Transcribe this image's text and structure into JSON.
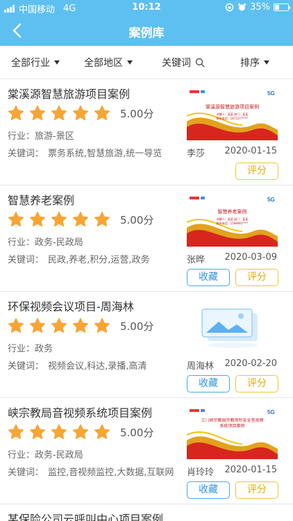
{
  "status": {
    "carrier": "中国移动",
    "network": "4G",
    "time": "10:12",
    "battery": "35%",
    "battery_level": 0.35
  },
  "nav": {
    "title": "案例库",
    "back_icon": "chevron-left-icon"
  },
  "filters": {
    "industry": "全部行业",
    "region": "全部地区",
    "keyword": "关键词",
    "sort": "排序"
  },
  "labels": {
    "industry_prefix": "行业：",
    "keyword_prefix": "关键词：",
    "favorite": "收藏",
    "rate": "评分",
    "score_unit": "分"
  },
  "colors": {
    "accent": "#5ec0f1",
    "star": "#f7a534",
    "favorite_border": "#46a8ea",
    "rate_border": "#f2c533"
  },
  "cases": [
    {
      "title": "棠溪源智慧旅游项目案例",
      "rating": 5,
      "score": "5.00分",
      "industry": "行业：旅游-景区",
      "keywords": "票务系统,智慧旅游,统一导览",
      "author": "李莎",
      "date": "2020-01-15",
      "thumb_title": "棠溪源智慧旅游项目案例",
      "thumb_line1": "讲解人：某某 部门：某某",
      "thumb_line2": "联系电话：1871577****",
      "thumb_badge": "5G",
      "has_favorite": false
    },
    {
      "title": "智慧养老案例",
      "rating": 5,
      "score": "5.00分",
      "industry": "行业：政务-民政局",
      "keywords": "民政,养老,积分,运营,政务",
      "author": "张晔",
      "date": "2020-03-09",
      "thumb_title": "智慧养老案例",
      "thumb_line1": "讲解人：某某 部门：某某",
      "thumb_line2": "联系电话：1598981****",
      "thumb_badge": "5G",
      "has_favorite": true
    },
    {
      "title": "环保视频会议项目-周海林",
      "rating": 5,
      "score": "5.00分",
      "industry": "行业：政务",
      "keywords": "视频会议,科达,录播,高清",
      "author": "周海林",
      "date": "2020-02-20",
      "thumb_title": "",
      "thumb_line1": "",
      "thumb_line2": "",
      "thumb_badge": "",
      "has_favorite": true
    },
    {
      "title": "峡宗教局音视频系统项目案例",
      "rating": 5,
      "score": "5.00分",
      "industry": "行业：政务-民政局",
      "keywords": "监控,音视频监控,大数据,互联网",
      "author": "肖玲玲",
      "date": "2020-01-15",
      "thumb_title": "三门峡宗教局宗教场所安全音视频系统项目案例",
      "thumb_line1": "",
      "thumb_line2": "",
      "thumb_badge": "5G",
      "has_favorite": true
    },
    {
      "title": "某保险公司云呼叫中心项目案例"
    }
  ]
}
